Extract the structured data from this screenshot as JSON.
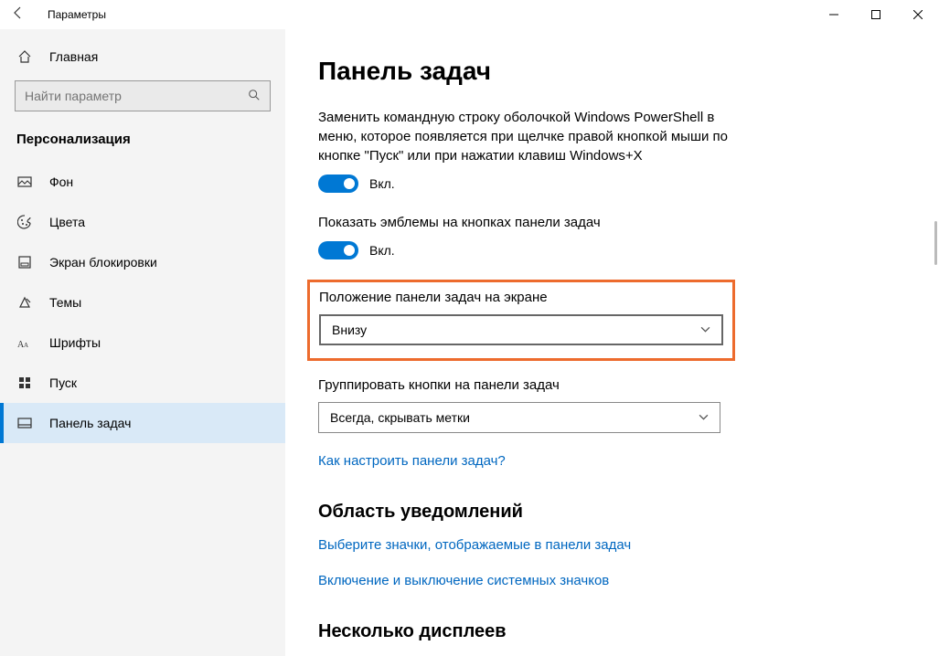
{
  "titlebar": {
    "title": "Параметры"
  },
  "sidebar": {
    "home": "Главная",
    "search_placeholder": "Найти параметр",
    "category": "Персонализация",
    "items": [
      {
        "label": "Фон"
      },
      {
        "label": "Цвета"
      },
      {
        "label": "Экран блокировки"
      },
      {
        "label": "Темы"
      },
      {
        "label": "Шрифты"
      },
      {
        "label": "Пуск"
      },
      {
        "label": "Панель задач"
      }
    ]
  },
  "main": {
    "title": "Панель задач",
    "powershell_desc": "Заменить командную строку оболочкой Windows PowerShell в меню, которое появляется при щелчке правой кнопкой мыши по кнопке \"Пуск\" или при нажатии клавиш Windows+X",
    "on_label": "Вкл.",
    "badges_desc": "Показать эмблемы на кнопках панели задач",
    "position_label": "Положение панели задач на экране",
    "position_value": "Внизу",
    "combine_label": "Группировать кнопки на панели задач",
    "combine_value": "Всегда, скрывать метки",
    "help_link": "Как настроить панели задач?",
    "section_notify": "Область уведомлений",
    "link_icons": "Выберите значки, отображаемые в панели задач",
    "link_system_icons": "Включение и выключение системных значков",
    "section_multi": "Несколько дисплеев"
  }
}
